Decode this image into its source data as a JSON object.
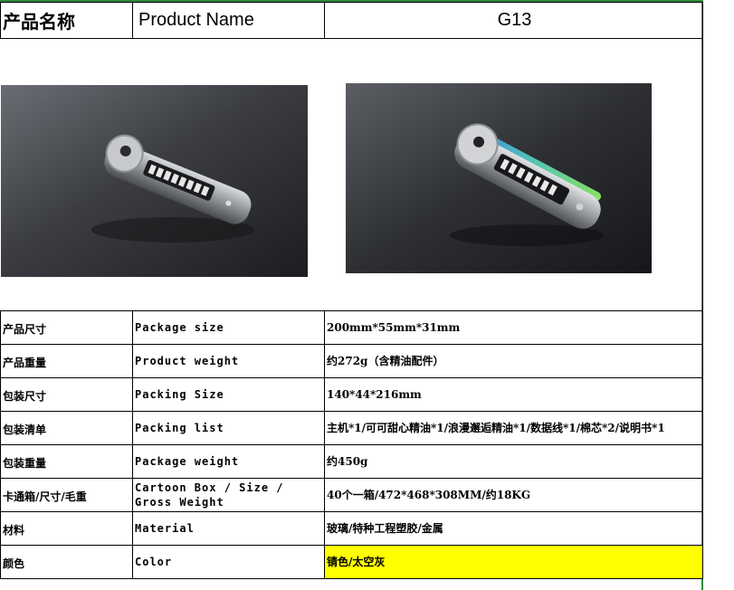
{
  "header": {
    "label_cn": "产品名称",
    "label_en": "Product Name",
    "model": "G13"
  },
  "images": [
    {
      "alt": "product-photo-front"
    },
    {
      "alt": "product-photo-lit"
    }
  ],
  "rows": [
    {
      "cn": "产品尺寸",
      "en": "Package size",
      "value": "200mm*55mm*31mm"
    },
    {
      "cn": "产品重量",
      "en": "Product weight",
      "value": "约272g（含精油配件）"
    },
    {
      "cn": "包装尺寸",
      "en": "Packing Size",
      "value": "140*44*216mm"
    },
    {
      "cn": "包装清单",
      "en": "Packing list",
      "value": "主机*1/可可甜心精油*1/浪漫邂逅精油*1/数据线*1/棉芯*2/说明书*1"
    },
    {
      "cn": "包装重量",
      "en": "Package weight",
      "value": "约450g"
    },
    {
      "cn": "卡通箱/尺寸/毛重",
      "en": "Cartoon Box / Size / Gross Weight",
      "value": "40个一箱/472*468*308MM/约18KG"
    },
    {
      "cn": "材料",
      "en": "Material",
      "value": "玻璃/特种工程塑胶/金属"
    },
    {
      "cn": "颜色",
      "en": "Color",
      "value": "锖色/太空灰"
    }
  ],
  "colors": {
    "border_accent": "#2e8b3e",
    "highlight": "#ffff00"
  }
}
